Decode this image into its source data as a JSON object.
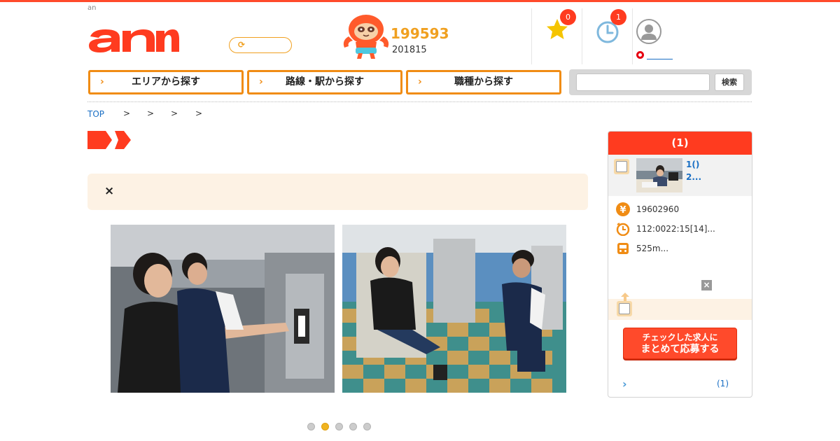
{
  "header": {
    "tagline": "an",
    "logo_text": "an",
    "counter_main": "199593",
    "counter_sub": "201815",
    "favorites_count": "0",
    "history_count": "1"
  },
  "nav": {
    "area": "エリアから探す",
    "route": "路線・駅から探す",
    "job": "職種から探す",
    "search_button": "検索",
    "search_placeholder": ""
  },
  "breadcrumb": {
    "top": "TOP",
    "separators": [
      ">",
      ">",
      ">",
      ">"
    ]
  },
  "notice": {
    "close": "×"
  },
  "carousel": {
    "dots": 5,
    "active_index": 1
  },
  "side_panel": {
    "title": "(1)",
    "job_line1": "1()",
    "job_line2": "2...",
    "salary": "19602960",
    "hours": "112:0022:15[14]...",
    "access": "525m...",
    "close": "×",
    "apply_line1": "チェックした求人に",
    "apply_line2": "まとめて応募する",
    "list_link": "(1)"
  },
  "colors": {
    "brand_red": "#ff3b1f",
    "accent_orange": "#f08c14",
    "link_blue": "#1a6fc4",
    "notice_bg": "#fdf2e4"
  }
}
